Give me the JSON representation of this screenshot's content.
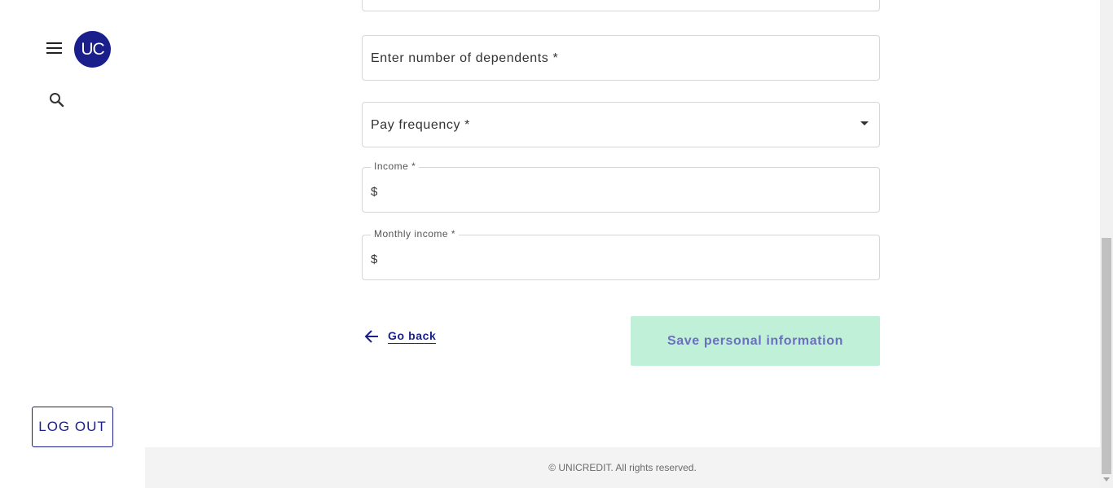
{
  "sidebar": {
    "avatar_text": "UC",
    "menu_icon": "hamburger-menu-icon",
    "search_icon": "search-icon",
    "logout_label": "LOG OUT"
  },
  "form": {
    "dependents": {
      "placeholder": "Enter number of dependents *"
    },
    "pay_frequency": {
      "placeholder": "Pay frequency *"
    },
    "income": {
      "label": "Income *",
      "prefix": "$",
      "value": ""
    },
    "monthly_income": {
      "label": "Monthly income *",
      "prefix": "$",
      "value": ""
    }
  },
  "actions": {
    "go_back_label": "Go back",
    "save_label": "Save personal information"
  },
  "footer": {
    "text": "© UNICREDIT. All rights reserved."
  },
  "colors": {
    "brand": "#1a1f8c",
    "save_bg": "#c1f0d9",
    "footer_bg": "#f3f3f3"
  }
}
